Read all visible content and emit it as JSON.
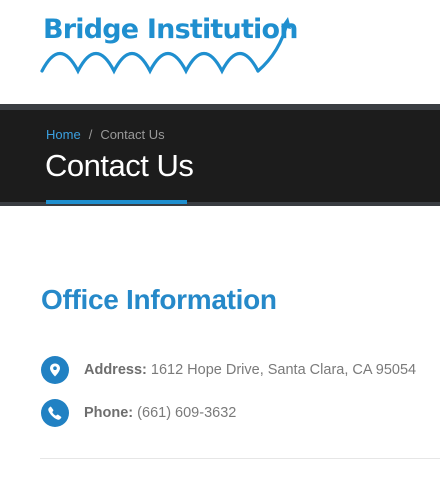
{
  "brand": {
    "name": "Bridge Institution",
    "color": "#1f8fcf"
  },
  "breadcrumb": {
    "home": "Home",
    "separator": "/",
    "current": "Contact Us"
  },
  "page": {
    "title": "Contact Us"
  },
  "office": {
    "heading": "Office Information",
    "address_label": "Address:",
    "address_value": "1612 Hope Drive, Santa Clara, CA 95054",
    "address_icon": "map-pin-icon",
    "phone_label": "Phone:",
    "phone_value": "(661) 609-3632",
    "phone_icon": "phone-icon"
  },
  "colors": {
    "accent": "#1f8fcf",
    "title_bar": "#1c1c1c",
    "icon_bg": "#2181c3"
  }
}
